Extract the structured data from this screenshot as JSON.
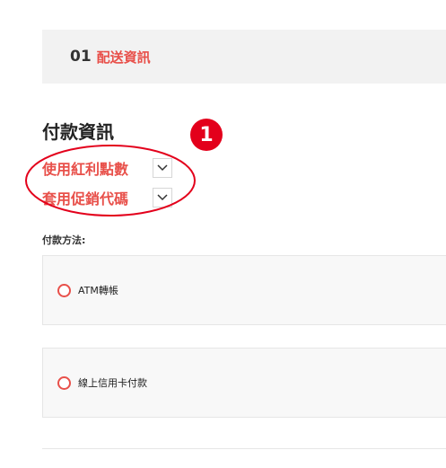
{
  "step": {
    "number": "01",
    "label": "配送資訊"
  },
  "payment": {
    "title": "付款資訊",
    "badge": "1",
    "toggles": [
      {
        "label": "使用紅利點數",
        "icon": "chevron-down-icon"
      },
      {
        "label": "套用促銷代碼",
        "icon": "chevron-down-icon"
      }
    ],
    "method_label": "付款方法:",
    "methods": [
      {
        "label": "ATM轉帳",
        "selected": false
      },
      {
        "label": "線上信用卡付款",
        "selected": false
      }
    ]
  },
  "colors": {
    "accent": "#e8504a",
    "badge": "#e3001b",
    "annotation": "#e3001b"
  }
}
